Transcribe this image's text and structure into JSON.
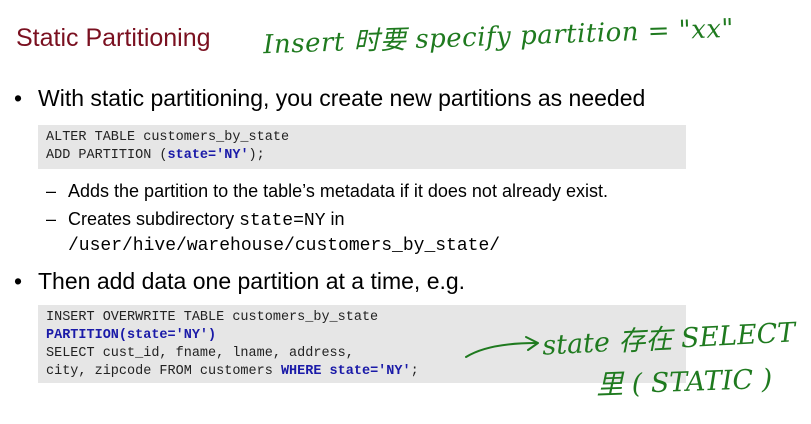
{
  "slide": {
    "title": "Static Partitioning",
    "handwritten_top": "Insert 时要 specify partition = \"xx\"",
    "bullet1": "With static partitioning, you create new partitions as needed",
    "code1": {
      "line1": "ALTER TABLE customers_by_state",
      "line2_pre": "ADD PARTITION (",
      "line2_kw": "state='NY'",
      "line2_post": ");"
    },
    "sub1": "Adds the partition to the table’s metadata if it does not already exist.",
    "sub2_text": "Creates subdirectory ",
    "sub2_code": "state=NY",
    "sub2_after": " in",
    "sub2_path": "/user/hive/warehouse/customers_by_state/",
    "bullet2": "Then add data one partition at a time, e.g.",
    "code2": {
      "line1": "INSERT OVERWRITE TABLE customers_by_state",
      "line2_kw": "PARTITION(state='NY')",
      "line3": "SELECT cust_id, fname, lname, address,",
      "line4_pre": "city, zipcode FROM customers ",
      "line4_kw": "WHERE state='NY'",
      "line4_post": ";"
    },
    "handwritten_right1": "state 存在 SELECT",
    "handwritten_right2": "里 ( STATIC )"
  }
}
